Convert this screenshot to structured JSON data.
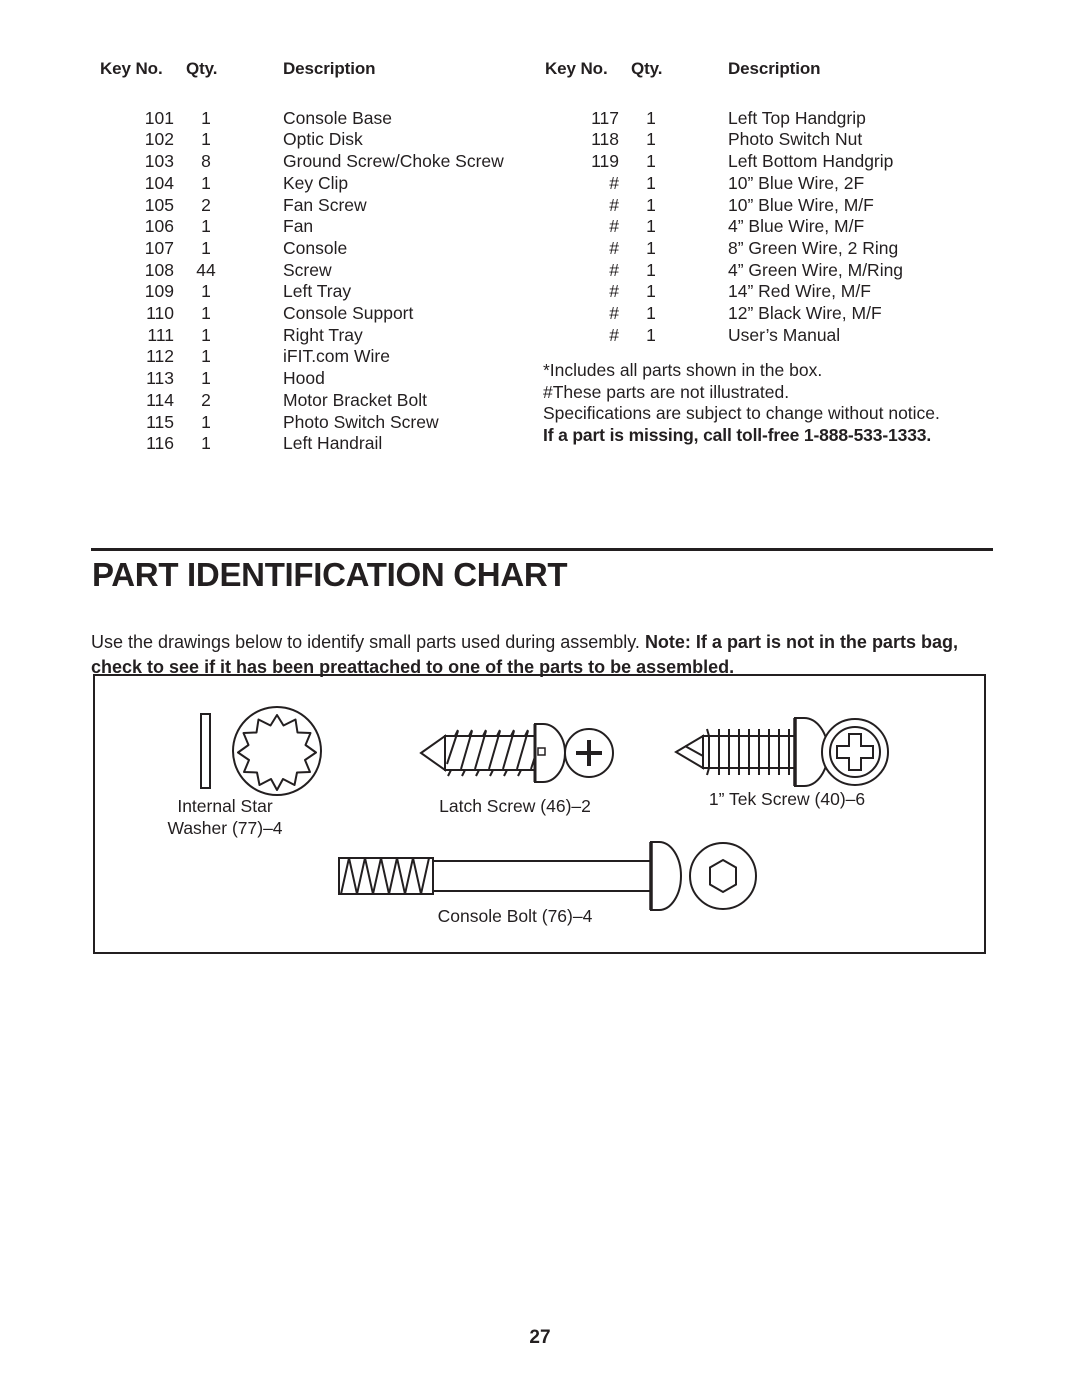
{
  "parts_list": {
    "headers": [
      "Key No.",
      "Qty.",
      "Description"
    ],
    "left_column": [
      {
        "key": "101",
        "qty": "1",
        "desc": "Console Base"
      },
      {
        "key": "102",
        "qty": "1",
        "desc": "Optic Disk"
      },
      {
        "key": "103",
        "qty": "8",
        "desc": "Ground Screw/Choke Screw"
      },
      {
        "key": "104",
        "qty": "1",
        "desc": "Key Clip"
      },
      {
        "key": "105",
        "qty": "2",
        "desc": "Fan Screw"
      },
      {
        "key": "106",
        "qty": "1",
        "desc": "Fan"
      },
      {
        "key": "107",
        "qty": "1",
        "desc": "Console"
      },
      {
        "key": "108",
        "qty": "44",
        "desc": "Screw"
      },
      {
        "key": "109",
        "qty": "1",
        "desc": "Left Tray"
      },
      {
        "key": "110",
        "qty": "1",
        "desc": "Console Support"
      },
      {
        "key": "111",
        "qty": "1",
        "desc": "Right Tray"
      },
      {
        "key": "112",
        "qty": "1",
        "desc": "iFIT.com Wire"
      },
      {
        "key": "113",
        "qty": "1",
        "desc": "Hood"
      },
      {
        "key": "114",
        "qty": "2",
        "desc": "Motor Bracket Bolt"
      },
      {
        "key": "115",
        "qty": "1",
        "desc": "Photo Switch Screw"
      },
      {
        "key": "116",
        "qty": "1",
        "desc": "Left Handrail"
      }
    ],
    "right_column": [
      {
        "key": "117",
        "qty": "1",
        "desc": "Left Top Handgrip"
      },
      {
        "key": "118",
        "qty": "1",
        "desc": "Photo Switch Nut"
      },
      {
        "key": "119",
        "qty": "1",
        "desc": "Left Bottom Handgrip"
      },
      {
        "key": "#",
        "qty": "1",
        "desc": "10” Blue Wire, 2F"
      },
      {
        "key": "#",
        "qty": "1",
        "desc": "10” Blue Wire, M/F"
      },
      {
        "key": "#",
        "qty": "1",
        "desc": "4” Blue Wire, M/F"
      },
      {
        "key": "#",
        "qty": "1",
        "desc": "8” Green Wire, 2 Ring"
      },
      {
        "key": "#",
        "qty": "1",
        "desc": "4” Green Wire, M/Ring"
      },
      {
        "key": "#",
        "qty": "1",
        "desc": "14” Red Wire, M/F"
      },
      {
        "key": "#",
        "qty": "1",
        "desc": "12” Black Wire, M/F"
      },
      {
        "key": "#",
        "qty": "1",
        "desc": "User’s Manual"
      }
    ]
  },
  "footnotes": {
    "line1": "*Includes all parts shown in the box.",
    "line2": "#These parts are not illustrated.",
    "line3": "Specifications are subject to change without notice.",
    "line4": "If a part is missing, call toll-free 1-888-533-1333."
  },
  "section": {
    "title": "PART IDENTIFICATION CHART",
    "intro_plain": "Use the drawings below to identify small parts used during assembly. ",
    "intro_bold": "Note: If a part is not in the parts bag, check to see if it has been preattached to one of the parts to be assembled."
  },
  "diagram": {
    "parts": [
      {
        "name": "internal-star-washer",
        "label_line1": "Internal Star",
        "label_line2": "Washer (77)–4"
      },
      {
        "name": "latch-screw",
        "label_line1": "Latch Screw (46)–2",
        "label_line2": ""
      },
      {
        "name": "tek-screw",
        "label_line1": "1” Tek Screw (40)–6",
        "label_line2": ""
      },
      {
        "name": "console-bolt",
        "label_line1": "Console Bolt (76)–4",
        "label_line2": ""
      }
    ]
  },
  "page_number": "27",
  "colors": {
    "ink": "#231f20",
    "paper": "#ffffff"
  }
}
